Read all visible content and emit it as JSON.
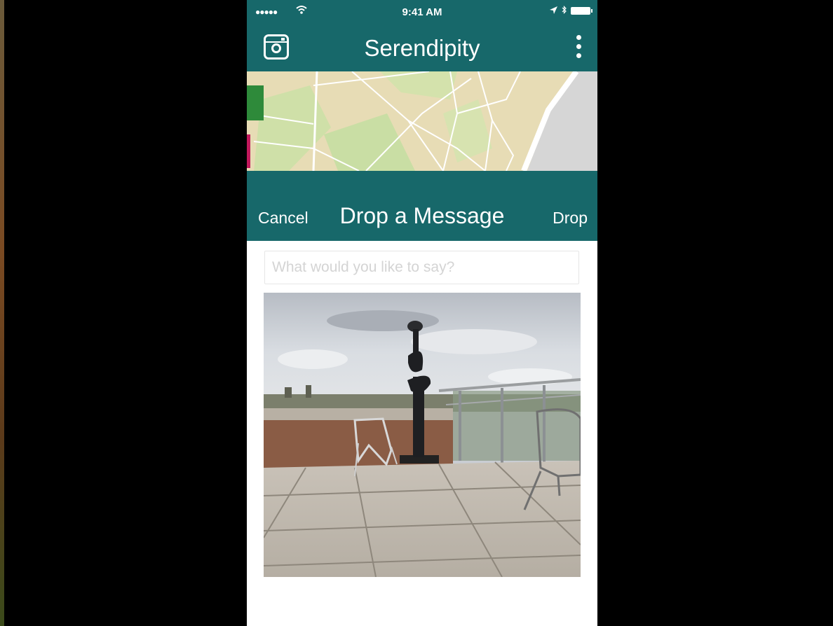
{
  "status_bar": {
    "signal": "●●●●●",
    "time": "9:41 AM"
  },
  "nav": {
    "title": "Serendipity"
  },
  "drop_message": {
    "cancel_label": "Cancel",
    "title": "Drop a Message",
    "drop_label": "Drop"
  },
  "compose": {
    "input_placeholder": "What would you like to say?",
    "input_value": ""
  },
  "colors": {
    "brand_teal": "#17686a",
    "map_land": "#e7dcb5",
    "map_park": "#c9dea4",
    "map_water": "#d6d6d6"
  },
  "icons": {
    "app": "instagram-camera-icon",
    "menu": "kebab-menu-icon",
    "wifi": "wifi-icon",
    "location": "location-arrow-icon",
    "battery": "battery-icon"
  }
}
